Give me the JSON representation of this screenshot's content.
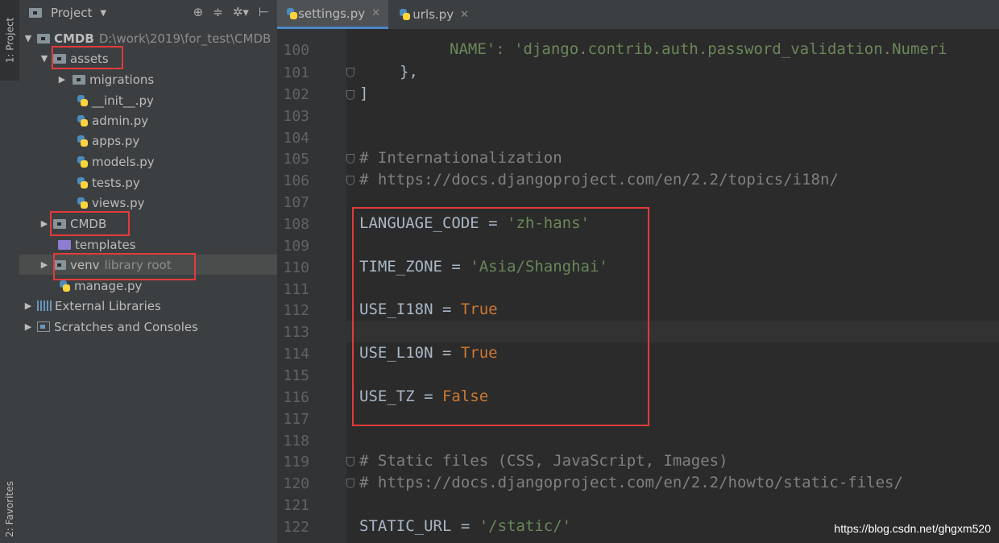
{
  "side_strip": {
    "project_tab": "1: Project",
    "favorites_tab": "2: Favorites"
  },
  "project_panel": {
    "title": "Project",
    "tree": [
      {
        "label": "CMDB",
        "extra": "D:\\work\\2019\\for_test\\CMDB"
      },
      {
        "label": "assets"
      },
      {
        "label": "migrations"
      },
      {
        "label": "__init__.py"
      },
      {
        "label": "admin.py"
      },
      {
        "label": "apps.py"
      },
      {
        "label": "models.py"
      },
      {
        "label": "tests.py"
      },
      {
        "label": "views.py"
      },
      {
        "label": "CMDB"
      },
      {
        "label": "templates"
      },
      {
        "label": "venv",
        "extra": "library root"
      },
      {
        "label": "manage.py"
      },
      {
        "label": "External Libraries"
      },
      {
        "label": "Scratches and Consoles"
      }
    ]
  },
  "editor": {
    "tabs": [
      {
        "label": "settings.py"
      },
      {
        "label": "urls.py"
      }
    ],
    "lines": [
      {
        "no": "100",
        "text": "NAME': 'django.contrib.auth.password_validation.NumericPasswordValidator',"
      },
      {
        "no": "101",
        "text": "},"
      },
      {
        "no": "102",
        "text": "]"
      },
      {
        "no": "103",
        "text": ""
      },
      {
        "no": "104",
        "text": ""
      },
      {
        "no": "105",
        "text": "# Internationalization"
      },
      {
        "no": "106",
        "text": "# https://docs.djangoproject.com/en/2.2/topics/i18n/"
      },
      {
        "no": "107",
        "text": ""
      },
      {
        "no": "108",
        "text": "LANGUAGE_CODE = 'zh-hans'"
      },
      {
        "no": "109",
        "text": ""
      },
      {
        "no": "110",
        "text": "TIME_ZONE = 'Asia/Shanghai'"
      },
      {
        "no": "111",
        "text": ""
      },
      {
        "no": "112",
        "text": "USE_I18N = True"
      },
      {
        "no": "113",
        "text": ""
      },
      {
        "no": "114",
        "text": "USE_L10N = True"
      },
      {
        "no": "115",
        "text": ""
      },
      {
        "no": "116",
        "text": "USE_TZ = False"
      },
      {
        "no": "117",
        "text": ""
      },
      {
        "no": "118",
        "text": ""
      },
      {
        "no": "119",
        "text": "# Static files (CSS, JavaScript, Images)"
      },
      {
        "no": "120",
        "text": "# https://docs.djangoproject.com/en/2.2/howto/static-files/"
      },
      {
        "no": "121",
        "text": ""
      },
      {
        "no": "122",
        "text": "STATIC_URL = '/static/'"
      }
    ],
    "tokens": {
      "l100_str": "NAME': 'django.contrib.auth.password_validation.Numeri",
      "l101": "},",
      "l102": "]",
      "l105": "# Internationalization",
      "l106": "# https://docs.djangoproject.com/en/2.2/topics/i18n/",
      "l108_name": "LANGUAGE_CODE = ",
      "l108_val": "'zh-hans'",
      "l110_name": "TIME_ZONE = ",
      "l110_val": "'Asia/Shanghai'",
      "l112_name": "USE_I18N = ",
      "l112_val": "True",
      "l114_name": "USE_L10N = ",
      "l114_val": "True",
      "l116_name": "USE_TZ = ",
      "l116_val": "False",
      "l119": "# Static files (CSS, JavaScript, Images)",
      "l120": "# https://docs.djangoproject.com/en/2.2/howto/static-files/",
      "l122_name": "STATIC_URL = ",
      "l122_val": "'/static/'"
    }
  },
  "watermark": "https://blog.csdn.net/ghgxm520"
}
